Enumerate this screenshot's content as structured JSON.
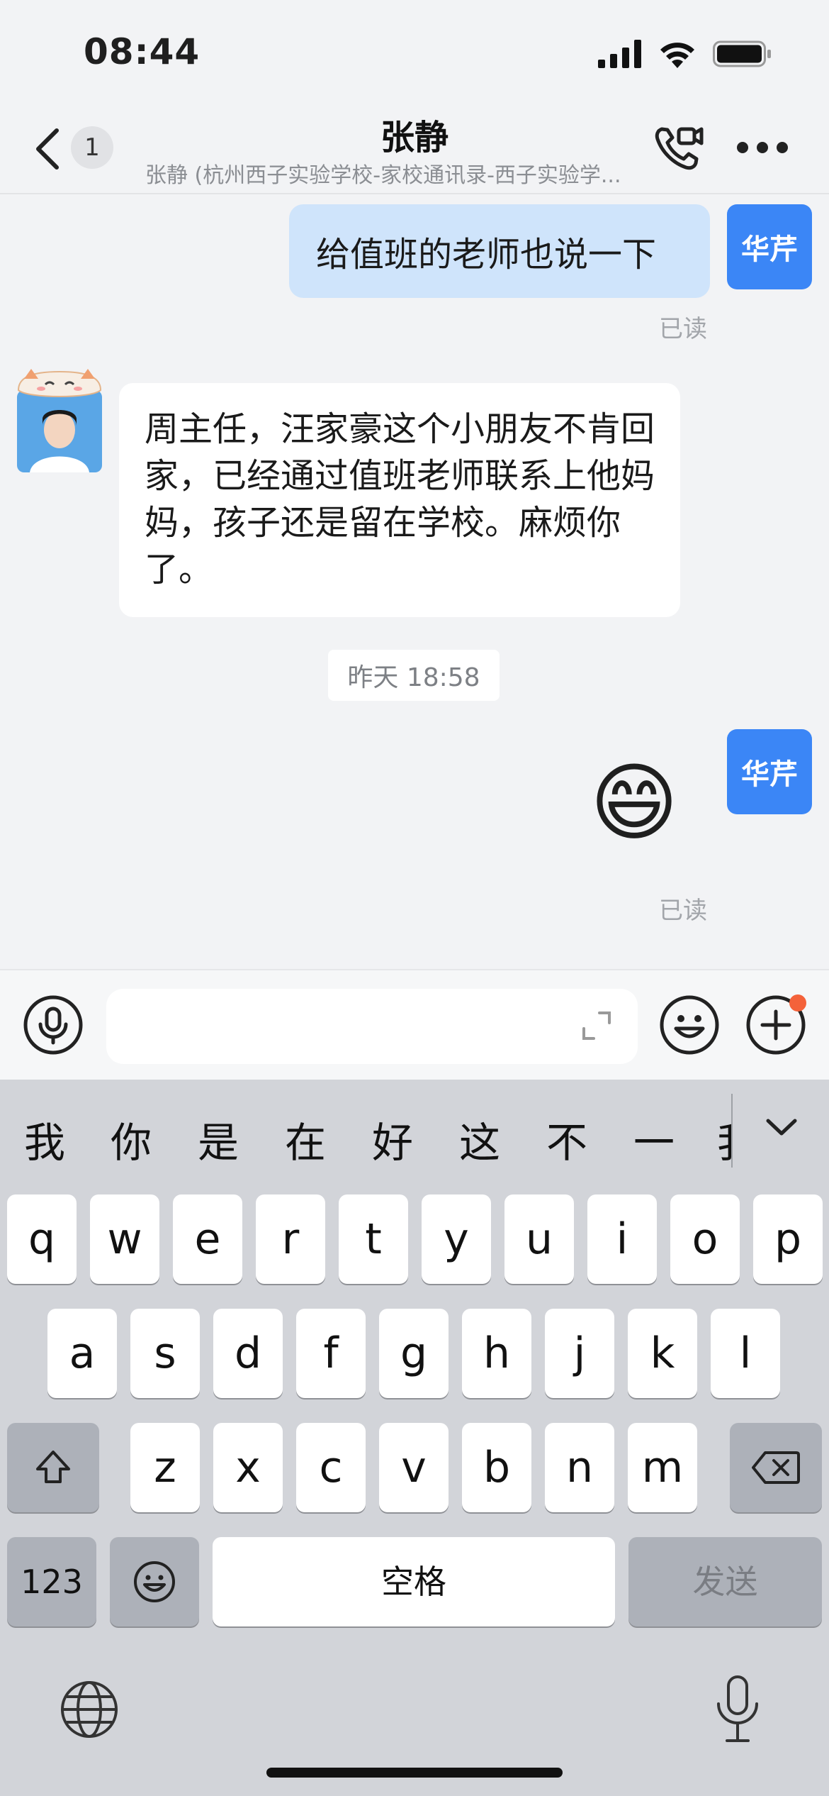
{
  "status_bar": {
    "time": "08:44"
  },
  "nav": {
    "unread_count": "1",
    "title": "张静",
    "subtitle": "张静 (杭州西子实验学校-家校通讯录-西子实验学..."
  },
  "messages": {
    "outgoing_1": {
      "avatar_label": "华芹",
      "text": "给值班的老师也说一下",
      "read_label": "已读"
    },
    "incoming_1": {
      "text": "周主任，汪家豪这个小朋友不肯回家，已经通过值班老师联系上他妈妈，孩子还是留在学校。麻烦你了。"
    },
    "timestamp": "昨天 18:58",
    "outgoing_2": {
      "avatar_label": "华芹",
      "emoji": "😄",
      "read_label": "已读"
    }
  },
  "input_bar": {
    "placeholder": ""
  },
  "keyboard": {
    "candidates": [
      "我",
      "你",
      "是",
      "在",
      "好",
      "这",
      "不",
      "一",
      "我"
    ],
    "row1": [
      "q",
      "w",
      "e",
      "r",
      "t",
      "y",
      "u",
      "i",
      "o",
      "p"
    ],
    "row2": [
      "a",
      "s",
      "d",
      "f",
      "g",
      "h",
      "j",
      "k",
      "l"
    ],
    "row3": [
      "z",
      "x",
      "c",
      "v",
      "b",
      "n",
      "m"
    ],
    "numbers_label": "123",
    "space_label": "空格",
    "send_label": "发送"
  },
  "colors": {
    "accent": "#3b86f6",
    "outgoing_bubble": "#cfe4fb",
    "badge_dot": "#f4623a"
  }
}
